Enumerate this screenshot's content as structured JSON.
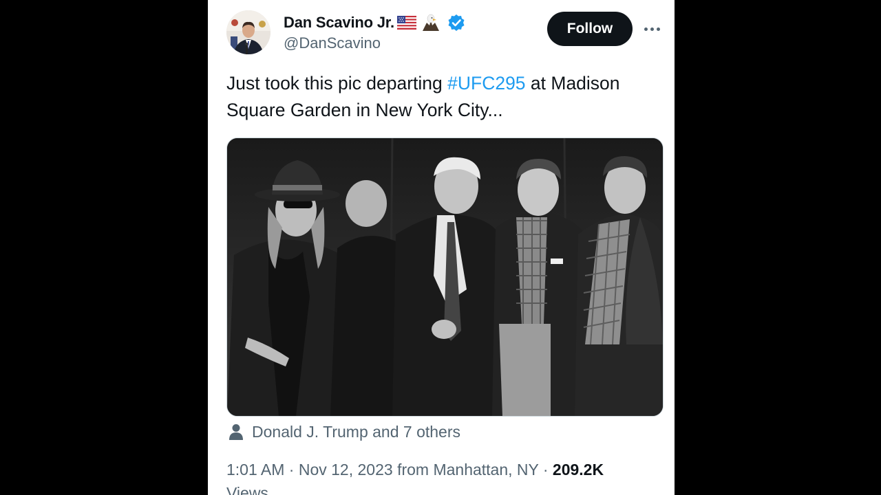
{
  "post": {
    "author": {
      "display_name": "Dan Scavino Jr.",
      "handle": "@DanScavino",
      "badges": [
        "us-flag-icon",
        "eagle-icon",
        "verified-badge-icon"
      ],
      "verified_color": "#1d9bf0"
    },
    "follow_label": "Follow",
    "text": {
      "part1": "Just took this pic departing ",
      "hashtag": "#UFC295",
      "part2": " at Madison Square Garden in New York City..."
    },
    "tagged": "Donald J. Trump and 7 others",
    "meta": {
      "time": "1:01 AM",
      "separator": "·",
      "date": "Nov 12, 2023",
      "location": "from Manhattan, NY",
      "views_count": "209.2K",
      "views_label": "Views"
    }
  },
  "colors": {
    "background": "#000000",
    "card": "#ffffff",
    "text_primary": "#0f1419",
    "text_secondary": "#536471",
    "accent": "#1d9bf0"
  }
}
